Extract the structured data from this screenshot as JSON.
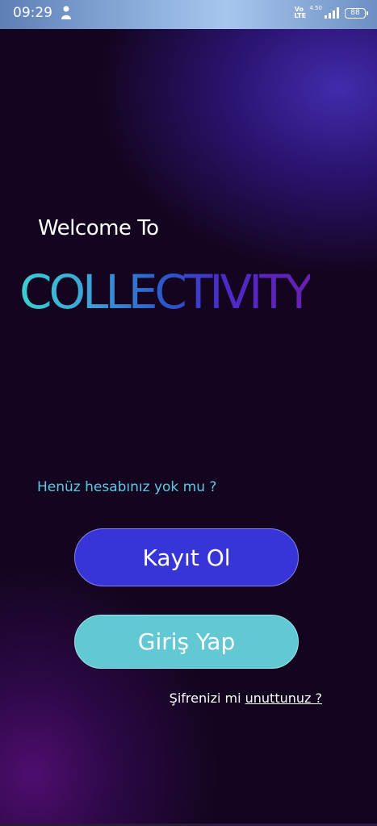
{
  "status_bar": {
    "time": "09:29",
    "volte": "Vo LTE",
    "net_speed": "4.50",
    "battery": "88"
  },
  "welcome_text": "Welcome To",
  "brand_name": "COLLECTIVITY",
  "no_account_text": "Henüz hesabınız yok mu ?",
  "register_button": "Kayıt Ol",
  "login_button": "Giriş Yap",
  "forgot": {
    "prefix": "Şifrenizi mi",
    "link": "unuttunuz ?"
  },
  "colors": {
    "register_button": "#3835d8",
    "login_button": "#62c9d4",
    "question_text": "#5fc8e2",
    "background": "#13051f"
  }
}
